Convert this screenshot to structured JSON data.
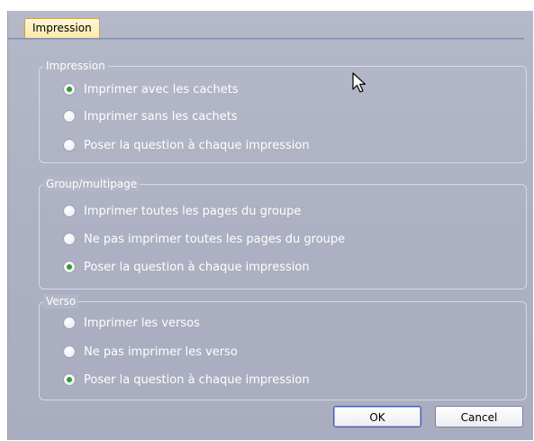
{
  "tab": {
    "label": "Impression"
  },
  "groups": [
    {
      "legend": "Impression",
      "options": [
        {
          "label": "Imprimer avec les cachets",
          "selected": true
        },
        {
          "label": "Imprimer sans les cachets",
          "selected": false
        },
        {
          "label": "Poser la question à chaque impression",
          "selected": false
        }
      ]
    },
    {
      "legend": "Group/multipage",
      "options": [
        {
          "label": "Imprimer toutes les pages du groupe",
          "selected": false
        },
        {
          "label": "Ne pas imprimer toutes les pages du groupe",
          "selected": false
        },
        {
          "label": "Poser la question à chaque impression",
          "selected": true
        }
      ]
    },
    {
      "legend": "Verso",
      "options": [
        {
          "label": "Imprimer les versos",
          "selected": false
        },
        {
          "label": "Ne pas imprimer les verso",
          "selected": false
        },
        {
          "label": "Poser la question à chaque impression",
          "selected": true
        }
      ]
    }
  ],
  "buttons": {
    "ok": "OK",
    "cancel": "Cancel"
  },
  "colors": {
    "dialog_bg": "#acb0c2",
    "tab_bg": "#fde8a8",
    "radio_selected": "#2f9e2f"
  }
}
